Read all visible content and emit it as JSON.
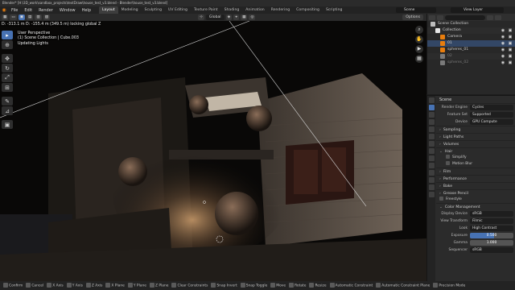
{
  "window": {
    "title": "Blender* [H:\\3D_work\\sandbox_projects\\textDraw\\house_test_v3.blend - Blender\\house_test_v3.blend]"
  },
  "menubar": {
    "menus": [
      "File",
      "Edit",
      "Render",
      "Window",
      "Help"
    ],
    "workspaces": [
      "Layout",
      "Modeling",
      "Sculpting",
      "UV Editing",
      "Texture Paint",
      "Shading",
      "Animation",
      "Rendering",
      "Compositing",
      "Scripting"
    ],
    "active_workspace": "Layout",
    "scene": "Scene",
    "view_layer": "View Layer"
  },
  "viewport_header": {
    "orientation": "Global",
    "options": "Options"
  },
  "viewport_overlay": {
    "transform_info": "D: -313.1 m  D: -155.4 m (349.5 m) locking global Z",
    "view_name": "User Perspective",
    "collection_info": "(1) Scene Collection | Cube.003",
    "status": "Updating Lights"
  },
  "outliner": {
    "rows": [
      {
        "label": "Scene Collection",
        "icon_color": "#bdbdbd",
        "indent": 0,
        "selected": false,
        "dim": false
      },
      {
        "label": "Collection",
        "icon_color": "#e6e6e6",
        "indent": 1,
        "selected": false,
        "dim": false
      },
      {
        "label": "Camera",
        "icon_color": "#e87d0d",
        "indent": 2,
        "selected": false,
        "dim": false
      },
      {
        "label": "01",
        "icon_color": "#e87d0d",
        "indent": 2,
        "selected": true,
        "dim": false
      },
      {
        "label": "spheres_01",
        "icon_color": "#e87d0d",
        "indent": 2,
        "selected": false,
        "dim": false
      },
      {
        "label": "02",
        "icon_color": "#7a7a7a",
        "indent": 2,
        "selected": false,
        "dim": true
      },
      {
        "label": "spheres_02",
        "icon_color": "#7a7a7a",
        "indent": 2,
        "selected": false,
        "dim": true
      }
    ]
  },
  "properties": {
    "header": "Scene",
    "render_engine_label": "Render Engine",
    "render_engine": "Cycles",
    "feature_set_label": "Feature Set",
    "feature_set": "Supported",
    "device_label": "Device",
    "device": "GPU Compute",
    "sections": [
      {
        "label": "Sampling",
        "expanded": false
      },
      {
        "label": "Light Paths",
        "expanded": false
      },
      {
        "label": "Volumes",
        "expanded": false
      },
      {
        "label": "Hair",
        "expanded": true
      }
    ],
    "hair_sub": [
      "Simplify",
      "Motion Blur"
    ],
    "sections2": [
      {
        "label": "Film",
        "expanded": false
      },
      {
        "label": "Performance",
        "expanded": false
      },
      {
        "label": "Bake",
        "expanded": false
      },
      {
        "label": "Grease Pencil",
        "expanded": false
      }
    ],
    "freestyle": "Freestyle",
    "color_mgmt": "Color Management",
    "display_device_label": "Display Device",
    "display_device": "sRGB",
    "view_transform_label": "View Transform",
    "view_transform": "Filmic",
    "look_label": "Look",
    "look": "High Contrast",
    "exposure_label": "Exposure",
    "exposure": "0.500",
    "exposure_fill": 0.55,
    "gamma_label": "Gamma",
    "gamma": "1.000",
    "sequencer_label": "Sequencer",
    "sequencer": "sRGB"
  },
  "statusbar": {
    "items": [
      "Confirm",
      "Cancel",
      "X Axis",
      "Y Axis",
      "Z Axis",
      "X Plane",
      "Y Plane",
      "Z Plane",
      "Clear Constraints",
      "Snap Invert",
      "Snap Toggle",
      "Move",
      "Rotate",
      "Resize",
      "Automatic Constraint",
      "Automatic Constraint Plane",
      "Precision Mode"
    ]
  },
  "colors": {
    "accent": "#4772b3",
    "blender_orange": "#e87d0d"
  }
}
